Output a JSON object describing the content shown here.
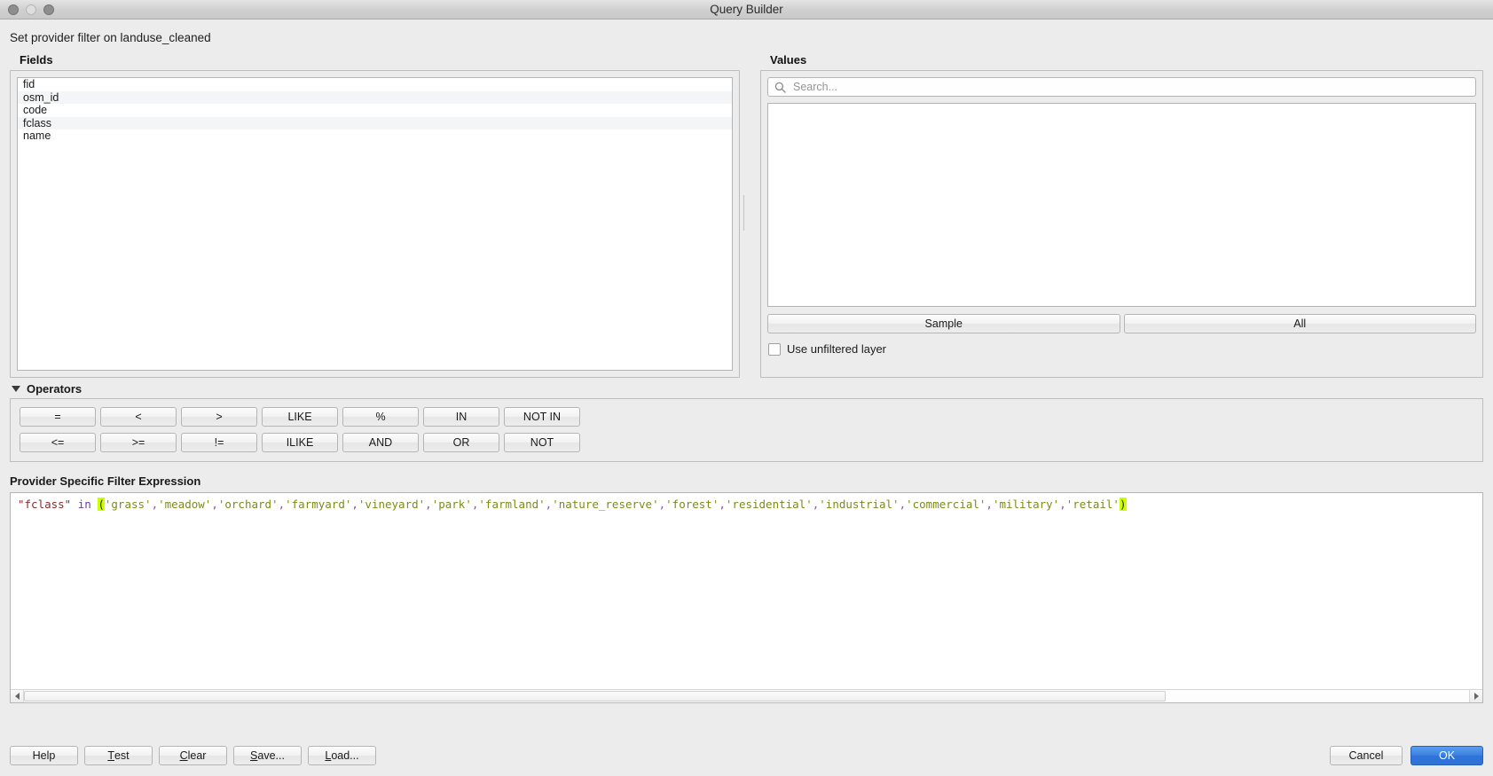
{
  "window": {
    "title": "Query Builder",
    "traffic_lights": [
      "close-button",
      "minimize-button",
      "maximize-button"
    ]
  },
  "subtitle": "Set provider filter on landuse_cleaned",
  "fields": {
    "label": "Fields",
    "items": [
      "fid",
      "osm_id",
      "code",
      "fclass",
      "name"
    ]
  },
  "values": {
    "label": "Values",
    "search_placeholder": "Search...",
    "search_value": "",
    "list_items": [],
    "sample_label": "Sample",
    "all_label": "All",
    "unfiltered_checkbox_label": "Use unfiltered layer",
    "unfiltered_checked": false
  },
  "operators": {
    "label": "Operators",
    "expanded": true,
    "row1": [
      "=",
      "<",
      ">",
      "LIKE",
      "%",
      "IN",
      "NOT IN"
    ],
    "row2": [
      "<=",
      ">=",
      "!=",
      "ILIKE",
      "AND",
      "OR",
      "NOT"
    ]
  },
  "filter": {
    "label": "Provider Specific Filter Expression",
    "expression": "\"fclass\" in ('grass','meadow','orchard','farmyard','vineyard','park','farmland','nature_reserve','forest','residential','industrial','commercial','military','retail')",
    "tokens": [
      {
        "t": "\"fclass\"",
        "k": "field"
      },
      {
        "t": " ",
        "k": "plain"
      },
      {
        "t": "in",
        "k": "op"
      },
      {
        "t": " ",
        "k": "plain"
      },
      {
        "t": "(",
        "k": "paren"
      },
      {
        "t": "'grass'",
        "k": "str"
      },
      {
        "t": ",",
        "k": "punct"
      },
      {
        "t": "'meadow'",
        "k": "str"
      },
      {
        "t": ",",
        "k": "punct"
      },
      {
        "t": "'orchard'",
        "k": "str"
      },
      {
        "t": ",",
        "k": "punct"
      },
      {
        "t": "'farmyard'",
        "k": "str"
      },
      {
        "t": ",",
        "k": "punct"
      },
      {
        "t": "'vineyard'",
        "k": "str"
      },
      {
        "t": ",",
        "k": "punct"
      },
      {
        "t": "'park'",
        "k": "str"
      },
      {
        "t": ",",
        "k": "punct"
      },
      {
        "t": "'farmland'",
        "k": "str"
      },
      {
        "t": ",",
        "k": "punct"
      },
      {
        "t": "'nature_reserve'",
        "k": "str"
      },
      {
        "t": ",",
        "k": "punct"
      },
      {
        "t": "'forest'",
        "k": "str"
      },
      {
        "t": ",",
        "k": "punct"
      },
      {
        "t": "'residential'",
        "k": "str"
      },
      {
        "t": ",",
        "k": "punct"
      },
      {
        "t": "'industrial'",
        "k": "str"
      },
      {
        "t": ",",
        "k": "punct"
      },
      {
        "t": "'commercial'",
        "k": "str"
      },
      {
        "t": ",",
        "k": "punct"
      },
      {
        "t": "'military'",
        "k": "str"
      },
      {
        "t": ",",
        "k": "punct"
      },
      {
        "t": "'retail'",
        "k": "str"
      },
      {
        "t": ")",
        "k": "paren"
      }
    ]
  },
  "footer": {
    "help_label": "Help",
    "test_label": "Test",
    "clear_label": "Clear",
    "save_label": "Save...",
    "load_label": "Load...",
    "cancel_label": "Cancel",
    "ok_label": "OK"
  },
  "colors": {
    "window_background": "#ececec",
    "accent_ok_button": "#2f73d9",
    "bracket_highlight": "#ccff00",
    "string_token": "#7c8c1a",
    "field_token": "#8b2b2b",
    "operator_token": "#6b3fa0"
  }
}
